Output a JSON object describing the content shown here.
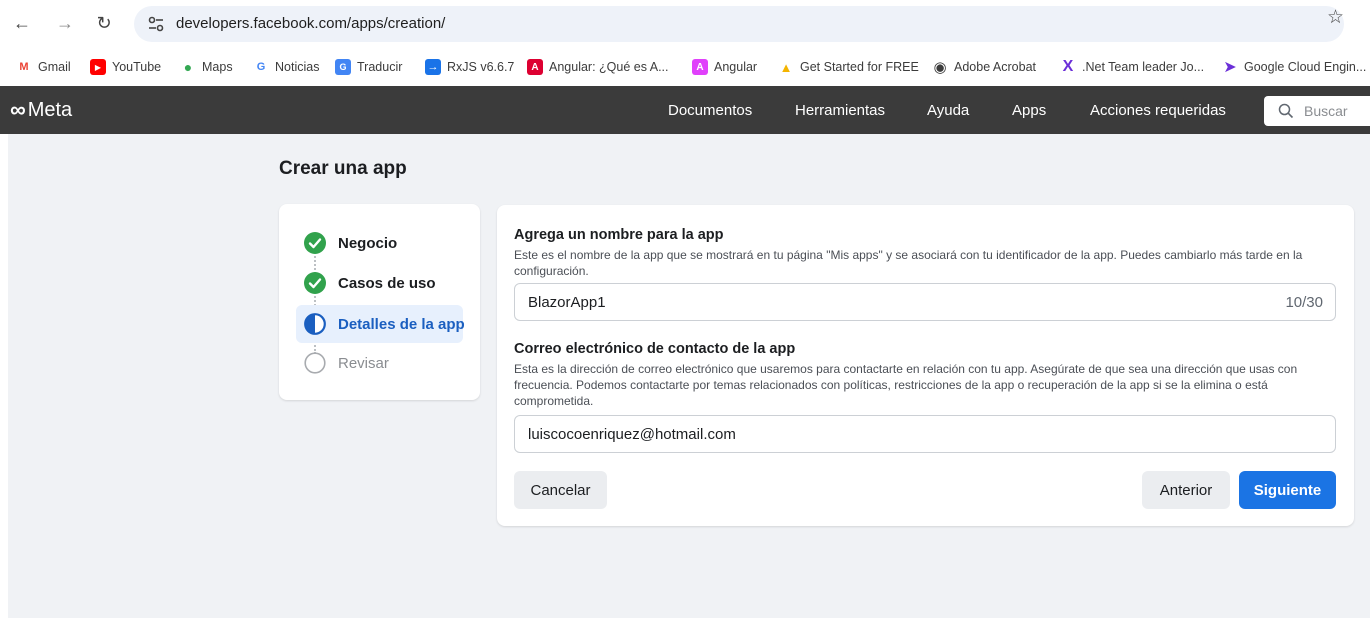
{
  "browser": {
    "url": "developers.facebook.com/apps/creation/",
    "bookmarks": [
      {
        "label": "Gmail",
        "icon": "gmail-icon",
        "color": "#ea4335"
      },
      {
        "label": "YouTube",
        "icon": "youtube-icon",
        "color": "#ff0000"
      },
      {
        "label": "Maps",
        "icon": "maps-icon",
        "color": "#34a853"
      },
      {
        "label": "Noticias",
        "icon": "news-icon",
        "color": "#4285f4"
      },
      {
        "label": "Traducir",
        "icon": "translate-icon",
        "color": "#4285f4"
      },
      {
        "label": "RxJS v6.6.7",
        "icon": "rxjs-icon",
        "color": "#1a73e8"
      },
      {
        "label": "Angular: ¿Qué es A...",
        "icon": "angular-icon",
        "color": "#dd0031"
      },
      {
        "label": "Angular",
        "icon": "angular-gradient-icon",
        "color": "#e040fb"
      },
      {
        "label": "Get Started for FREE",
        "icon": "bookmark-site-icon",
        "color": "#f4b400"
      },
      {
        "label": "Adobe Acrobat",
        "icon": "globe-icon",
        "color": "#3c3c3c"
      },
      {
        "label": ".Net Team leader Jo...",
        "icon": "x-logo-icon",
        "color": "#6b2fd8"
      },
      {
        "label": "Google Cloud Engin...",
        "icon": "google-cloud-icon",
        "color": "#6b2fd8"
      }
    ]
  },
  "header": {
    "logo": "Meta",
    "nav": [
      "Documentos",
      "Herramientas",
      "Ayuda",
      "Apps",
      "Acciones requeridas"
    ],
    "search_placeholder": "Buscar"
  },
  "page": {
    "title": "Crear una app",
    "steps": [
      {
        "label": "Negocio",
        "state": "done"
      },
      {
        "label": "Casos de uso",
        "state": "done"
      },
      {
        "label": "Detalles de la app",
        "state": "current"
      },
      {
        "label": "Revisar",
        "state": "pending"
      }
    ],
    "form": {
      "name_label": "Agrega un nombre para la app",
      "name_help": "Este es el nombre de la app que se mostrará en tu página \"Mis apps\" y se asociará con tu identificador de la app. Puedes cambiarlo más tarde en la configuración.",
      "name_value": "BlazorApp1",
      "name_counter": "10/30",
      "email_label": "Correo electrónico de contacto de la app",
      "email_help": "Esta es la dirección de correo electrónico que usaremos para contactarte en relación con tu app. Asegúrate de que sea una dirección que usas con frecuencia. Podemos contactarte por temas relacionados con políticas, restricciones de la app o recuperación de la app si se la elimina o está comprometida.",
      "email_value": "luiscocoenriquez@hotmail.com"
    },
    "buttons": {
      "cancel": "Cancelar",
      "back": "Anterior",
      "next": "Siguiente"
    }
  },
  "colors": {
    "accent": "#1b74e4",
    "success": "#31a24c",
    "header_bg": "#3b3b3b",
    "page_bg": "#f0f2f5"
  }
}
